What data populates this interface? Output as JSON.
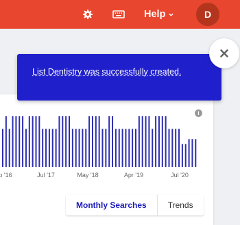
{
  "header": {
    "help_label": "Help",
    "avatar_initial": "D",
    "icons": [
      "gear-icon",
      "keyboard-icon",
      "chevron-down-icon"
    ],
    "accent_color": "#e8462e"
  },
  "toast": {
    "message": "List Dentistry was successfully created.",
    "background": "#1f1fcc",
    "close_icon": "close-icon"
  },
  "chart_data": {
    "type": "bar",
    "title": "",
    "xlabel": "",
    "ylabel": "",
    "x_tick_labels": [
      "p '16",
      "Jul '17",
      "May '18",
      "Apr '19",
      "Jul '20"
    ],
    "values": [
      75,
      100,
      75,
      100,
      100,
      100,
      100,
      75,
      100,
      100,
      100,
      100,
      75,
      75,
      75,
      75,
      75,
      100,
      100,
      100,
      100,
      75,
      75,
      75,
      75,
      75,
      100,
      100,
      100,
      100,
      75,
      75,
      100,
      100,
      75,
      75,
      75,
      75,
      75,
      75,
      75,
      100,
      100,
      100,
      100,
      75,
      100,
      100,
      100,
      100,
      75,
      75,
      75,
      75,
      45,
      45,
      55,
      55,
      55
    ],
    "bar_color": "#2d2db0",
    "grid": false
  },
  "tabs": [
    {
      "label": "Monthly Searches",
      "active": true
    },
    {
      "label": "Trends",
      "active": false
    }
  ]
}
